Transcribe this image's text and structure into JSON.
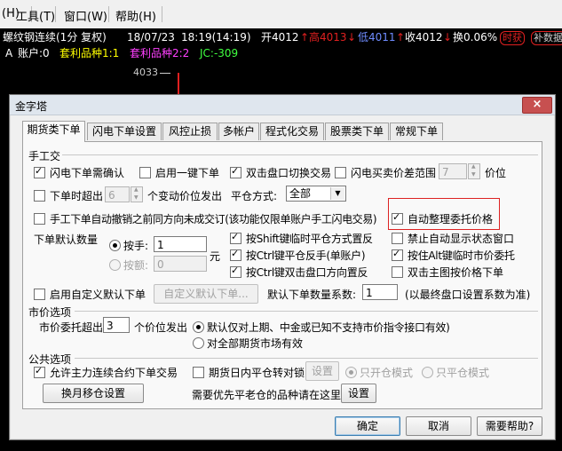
{
  "menu": {
    "items": [
      "(H)",
      "工具(T)",
      "窗口(W)",
      "帮助(H)"
    ]
  },
  "quote": {
    "symbol": "螺纹钢连续(1分 复权)",
    "date": "18/07/23",
    "time": "18:19(14:19)",
    "open_label": "开4012",
    "open_arrow": "↑",
    "high_label": "高4013",
    "high_arrow": "↓",
    "low_label": "低4011",
    "low_arrow": "↑",
    "close_label": "收4012",
    "close_arrow": "↓",
    "change_label": "换0.06%",
    "chip1": "时获",
    "chip2": "补数据"
  },
  "account_line": {
    "prefix": "A",
    "account": "账户:0",
    "arb1": "套利品种1:1",
    "arb2": "套利品种2:2",
    "jc": "JC:-309"
  },
  "chart": {
    "price_label": "4033"
  },
  "colors": {
    "red": "#e02020",
    "blue": "#5b7bff",
    "yellow": "#ffff00",
    "magenta": "#ff40ff",
    "green": "#40ff40",
    "white": "#ffffff"
  },
  "dialog": {
    "title": "金字塔",
    "close_icon": "×",
    "tabs": [
      "期货类下单",
      "闪电下单设置",
      "风控止损",
      "多帐户",
      "程式化交易",
      "股票类下单",
      "常规下单"
    ],
    "manual": {
      "section": "手工交",
      "flash_confirm": "闪电下单需确认",
      "one_click": "启用一键下单",
      "dblclick_switch": "双击盘口切换交易",
      "flash_spread": "闪电买卖价差范围",
      "spread_value": "7",
      "price_unit": "价位",
      "timeout": "下单时超出",
      "timeout_value": "6",
      "timeout_suffix": "个变动价位发出",
      "close_mode_label": "平仓方式:",
      "close_mode_value": "全部",
      "auto_cancel": "手工下单自动撤销之前同方向未成交订(该功能仅限单账户手工闪电交易)",
      "auto_arrange": "自动整理委托价格",
      "default_qty": "下单默认数量",
      "by_hand": "按手:",
      "hand_value": "1",
      "by_amount": "按额:",
      "amount_value": "0",
      "yuan": "元",
      "shift_close": "按Shift键临时平仓方式置反",
      "disable_status": "禁止自动显示状态窗口",
      "ctrl_reverse": "按Ctrl键平仓反手(单账户)",
      "alt_market": "按住Alt键临时市价委托",
      "ctrl_dbl": "按Ctrl键双击盘口方向置反",
      "dbl_chart": "双击主图按价格下单",
      "custom_qty": "启用自定义默认下单",
      "custom_qty_btn": "自定义默认下单...",
      "coef_label": "默认下单数量系数:",
      "coef_value": "1",
      "coef_note": "(以最终盘口设置系数为准)"
    },
    "market": {
      "section": "市价选项",
      "exceed_label": "市价委托超出",
      "exceed_value": "3",
      "exceed_suffix": "个价位发出",
      "only_futures": "默认仅对上期、中金或已知不支持市价指令接口有效)",
      "all_futures": "对全部期货市场有效"
    },
    "common": {
      "section": "公共选项",
      "allow_main": "允许主力连续合约下单交易",
      "intraday": "期货日内平仓转对锁",
      "set_btn": "设置",
      "open_only": "只开仓模式",
      "close_only": "只平仓模式",
      "rollover_btn": "换月移仓设置",
      "priority_note": "需要优先平老仓的品种请在这里",
      "priority_btn": "设置"
    },
    "footer": {
      "ok": "确定",
      "cancel": "取消",
      "help": "需要帮助?"
    }
  }
}
